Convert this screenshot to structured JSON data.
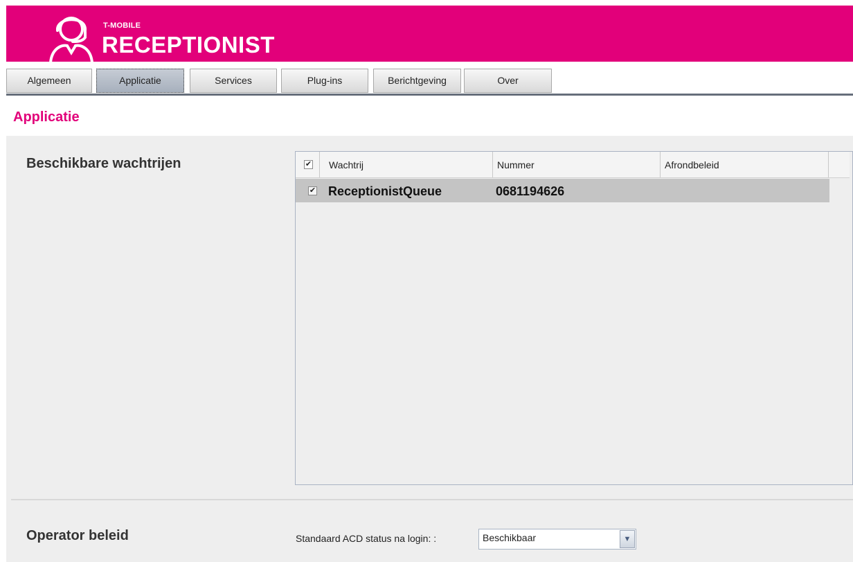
{
  "header": {
    "brand_small": "T-MOBILE",
    "brand_big": "RECEPTIONIST",
    "logo_icon": "operator-headset-icon",
    "color": "#e2007a"
  },
  "tabs": [
    {
      "label": "Algemeen",
      "active": false
    },
    {
      "label": "Applicatie",
      "active": true
    },
    {
      "label": "Services",
      "active": false
    },
    {
      "label": "Plug-ins",
      "active": false
    },
    {
      "label": "Berichtgeving",
      "active": false
    },
    {
      "label": "Over",
      "active": false
    }
  ],
  "page": {
    "title": "Applicatie"
  },
  "queues": {
    "section_title": "Beschikbare wachtrijen",
    "columns": [
      "Wachtrij",
      "Nummer",
      "Afrondbeleid"
    ],
    "header_checked": true,
    "rows": [
      {
        "checked": true,
        "name": "ReceptionistQueue",
        "number": "0681194626",
        "policy": ""
      }
    ]
  },
  "operator": {
    "section_title": "Operator beleid",
    "acd_label": "Standaard ACD status na login: :",
    "acd_value": "Beschikbaar",
    "checkmark": "✔",
    "dropdown_icon": "chevron-down-icon"
  }
}
